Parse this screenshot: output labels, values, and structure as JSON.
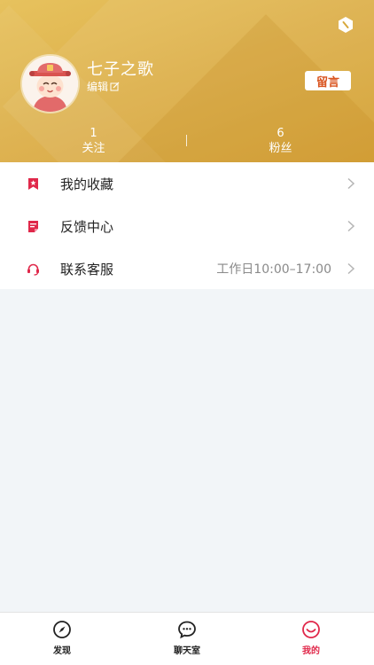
{
  "header": {
    "username": "七子之歌",
    "edit_label": "编辑",
    "message_button": "留言",
    "settings_icon": "settings-icon",
    "avatar": "avatar-character",
    "stats": [
      {
        "count": "1",
        "label": "关注"
      },
      {
        "count": "6",
        "label": "粉丝"
      }
    ],
    "colors": {
      "gradient_start": "#e7c25e",
      "gradient_end": "#d39e2f"
    }
  },
  "menu": {
    "items": [
      {
        "label": "我的收藏",
        "value": "",
        "icon": "bookmark-star-icon"
      },
      {
        "label": "反馈中心",
        "value": "",
        "icon": "feedback-note-icon"
      },
      {
        "label": "联系客服",
        "value": "工作日10:00–17:00",
        "icon": "headset-icon"
      }
    ]
  },
  "tabbar": {
    "tabs": [
      {
        "label": "发现",
        "icon": "compass-icon",
        "active": false
      },
      {
        "label": "聊天室",
        "icon": "chat-bubble-icon",
        "active": false
      },
      {
        "label": "我的",
        "icon": "smile-icon",
        "active": true
      }
    ],
    "active_color": "#e0284a"
  },
  "accent": {
    "red": "#e0284a",
    "orange": "#d9531e"
  }
}
